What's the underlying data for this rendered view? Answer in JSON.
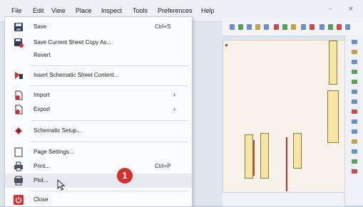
{
  "menubar": {
    "items": [
      "File",
      "Edit",
      "View",
      "Place",
      "Inspect",
      "Tools",
      "Preferences",
      "Help"
    ]
  },
  "window_controls": {
    "minimize": "–",
    "close": "×"
  },
  "file_menu": {
    "save": {
      "label": "Save",
      "shortcut": "Ctrl+S",
      "icon": "save-icon"
    },
    "save_copy": {
      "label": "Save Current Sheet Copy As...",
      "icon": "save-as-icon"
    },
    "revert": {
      "label": "Revert"
    },
    "insert_sheet": {
      "label": "Insert Schematic Sheet Content...",
      "icon": "insert-sheet-icon"
    },
    "import": {
      "label": "Import",
      "icon": "import-icon",
      "arrow": "›"
    },
    "export": {
      "label": "Export",
      "icon": "export-icon",
      "arrow": "›"
    },
    "schematic_setup": {
      "label": "Schematic Setup...",
      "icon": "setup-icon"
    },
    "page_settings": {
      "label": "Page Settings...",
      "icon": "page-settings-icon"
    },
    "print": {
      "label": "Print...",
      "shortcut": "Ctrl+P",
      "icon": "printer-icon"
    },
    "plot": {
      "label": "Plot...",
      "icon": "plot-icon"
    },
    "close": {
      "label": "Close",
      "icon": "power-icon"
    }
  },
  "annotation": {
    "number": "1"
  },
  "colors": {
    "accent_red": "#d62d2d",
    "menu_bg": "#fafbfc",
    "hover_bg": "#e7ebf1"
  }
}
